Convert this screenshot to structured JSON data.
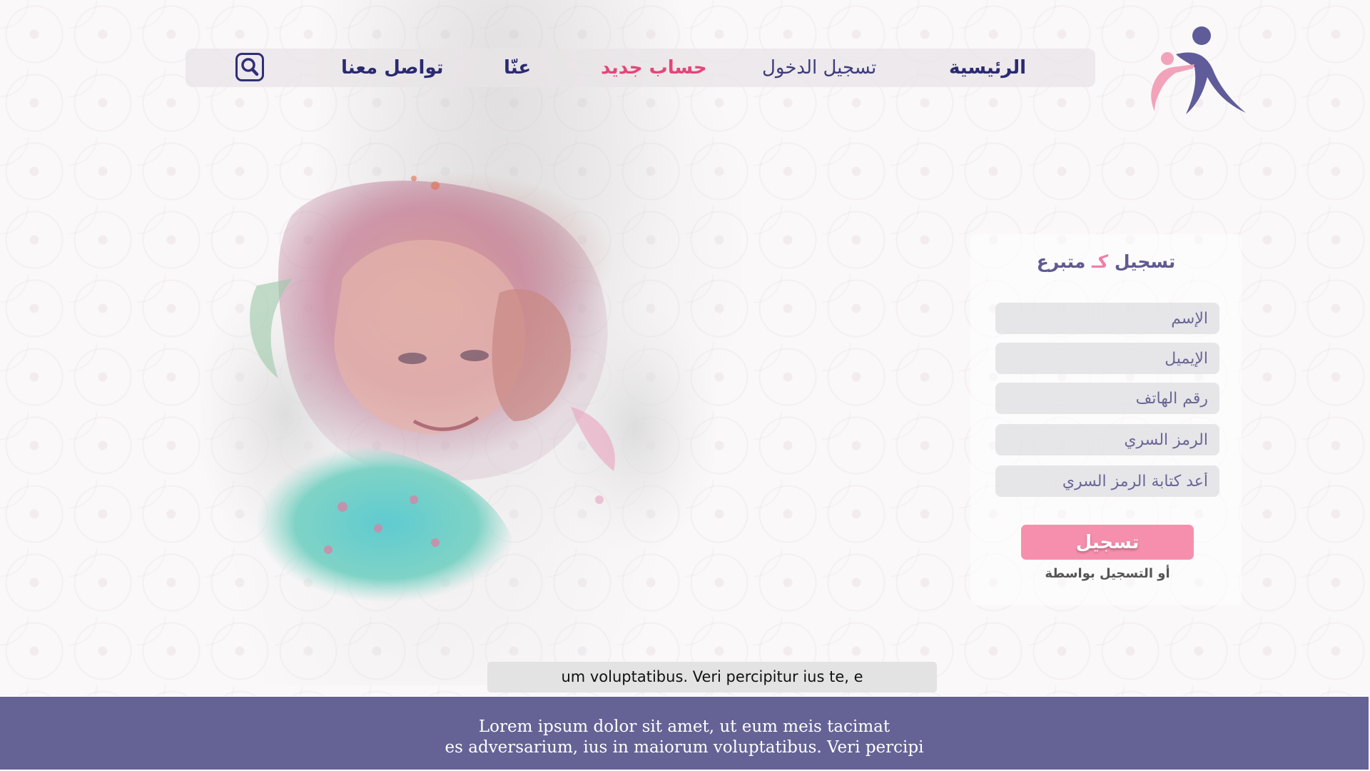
{
  "nav": {
    "home": "الرئيسية",
    "login": "تسجيل الدخول",
    "new_account": "حساب جديد",
    "about": "عنّا",
    "contact": "تواصل معنا",
    "search_icon": "search-icon"
  },
  "form": {
    "title_prefix": "تسجيل",
    "title_accent": "كـ",
    "title_suffix": "متبرع",
    "name_placeholder": "الإسم",
    "email_placeholder": "الإيميل",
    "phone_placeholder": "رقم الهاتف",
    "password_placeholder": "الرمز السري",
    "confirm_password_placeholder": "أعد كتابة الرمز السري",
    "submit_label": "تسجيل",
    "alt_signup_text": "أو التسجيل بواسطة"
  },
  "ticker": {
    "text": "um voluptatibus. Veri percipitur ius te, e"
  },
  "footer": {
    "line1": "Lorem ipsum dolor sit amet, ut eum meis tacimat",
    "line2": "es adversarium, ius in maiorum voluptatibus. Veri percipi"
  },
  "colors": {
    "brand_navy": "#2b2a70",
    "brand_pink": "#e4457a",
    "button_pink": "#f68fad",
    "footer_purple": "#656395"
  }
}
